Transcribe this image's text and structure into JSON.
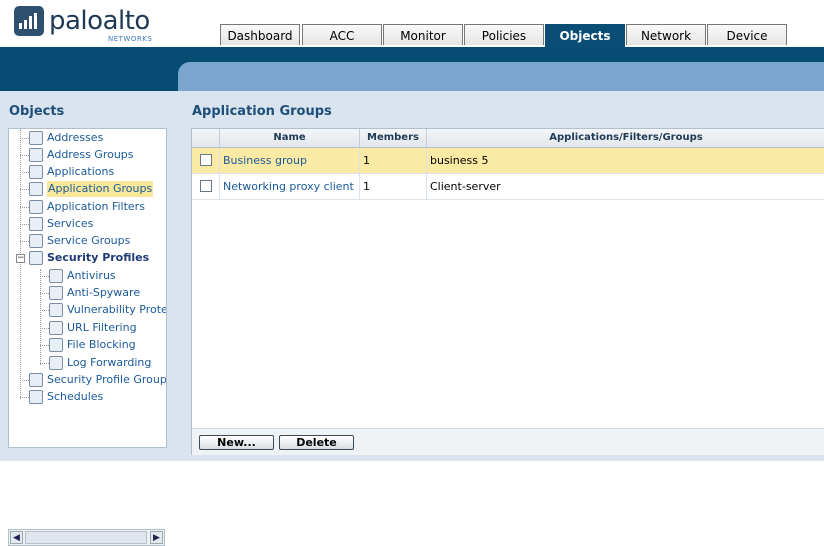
{
  "brand": {
    "name": "paloalto",
    "sub": "NETWORKS"
  },
  "tabs": [
    {
      "label": "Dashboard"
    },
    {
      "label": "ACC"
    },
    {
      "label": "Monitor"
    },
    {
      "label": "Policies"
    },
    {
      "label": "Objects",
      "active": true
    },
    {
      "label": "Network"
    },
    {
      "label": "Device"
    }
  ],
  "sidebar": {
    "title": "Objects",
    "items": [
      {
        "label": "Addresses",
        "icon": "addresses-icon"
      },
      {
        "label": "Address Groups",
        "icon": "address-groups-icon"
      },
      {
        "label": "Applications",
        "icon": "applications-icon"
      },
      {
        "label": "Application Groups",
        "icon": "application-groups-icon",
        "selected": true
      },
      {
        "label": "Application Filters",
        "icon": "application-filters-icon"
      },
      {
        "label": "Services",
        "icon": "services-icon"
      },
      {
        "label": "Service Groups",
        "icon": "service-groups-icon"
      },
      {
        "label": "Security Profiles",
        "icon": "security-profiles-icon",
        "expanded": true
      },
      {
        "label": "Antivirus",
        "icon": "antivirus-icon"
      },
      {
        "label": "Anti-Spyware",
        "icon": "anti-spyware-icon"
      },
      {
        "label": "Vulnerability Protectio",
        "icon": "vulnerability-protection-icon"
      },
      {
        "label": "URL Filtering",
        "icon": "url-filtering-icon"
      },
      {
        "label": "File Blocking",
        "icon": "file-blocking-icon"
      },
      {
        "label": "Log Forwarding",
        "icon": "log-forwarding-icon"
      },
      {
        "label": "Security Profile Groups",
        "icon": "security-profile-groups-icon"
      },
      {
        "label": "Schedules",
        "icon": "schedules-icon"
      }
    ]
  },
  "main": {
    "title": "Application Groups",
    "columns": [
      "Name",
      "Members",
      "Applications/Filters/Groups"
    ],
    "rows": [
      {
        "name": "Business group",
        "members": "1",
        "apps": "business 5",
        "selected": true
      },
      {
        "name": "Networking proxy client",
        "members": "1",
        "apps": "Client-server",
        "selected": false
      }
    ],
    "buttons": {
      "new": "New...",
      "delete": "Delete"
    }
  },
  "colors": {
    "header_blue": "#064b72",
    "band_blue": "#7aa5cf",
    "panel_bg": "#d9e4ee",
    "selected_row": "#fbeaa4",
    "link": "#1a5a9a"
  }
}
